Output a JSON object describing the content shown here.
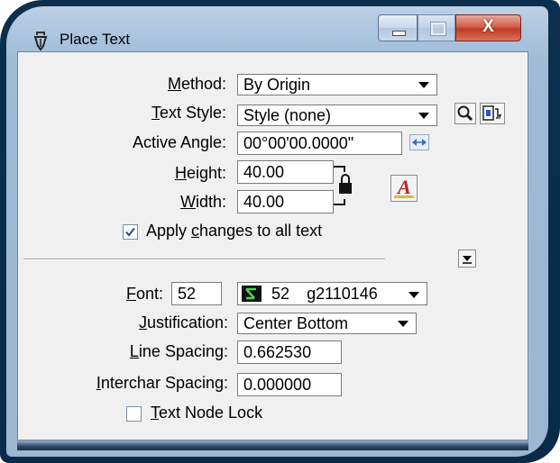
{
  "window": {
    "title": "Place Text",
    "close_glyph": "X"
  },
  "form": {
    "method": {
      "label_pre": "",
      "label_ul": "M",
      "label_post": "ethod:",
      "value": "By Origin"
    },
    "text_style": {
      "label_pre": "",
      "label_ul": "T",
      "label_post": "ext Style:",
      "value": "Style (none)"
    },
    "active_angle": {
      "label": "Active Angle:",
      "value": "00°00'00.0000\""
    },
    "height": {
      "label_pre": "",
      "label_ul": "H",
      "label_post": "eight:",
      "value": "40.00"
    },
    "width": {
      "label_pre": "",
      "label_ul": "W",
      "label_post": "idth:",
      "value": "40.00"
    },
    "apply_changes": {
      "label_pre": "Apply ",
      "label_ul": "c",
      "label_post": "hanges to all text",
      "checked": true
    },
    "font": {
      "label_pre": "",
      "label_ul": "F",
      "label_post": "ont:",
      "number": "52",
      "combo_num": "52",
      "combo_name": "g2110146"
    },
    "justification": {
      "label_pre": "",
      "label_ul": "J",
      "label_post": "ustification:",
      "value": "Center Bottom"
    },
    "line_spacing": {
      "label_pre": "",
      "label_ul": "L",
      "label_post": "ine Spacing:",
      "value": "0.662530"
    },
    "interchar_spacing": {
      "label_pre": "",
      "label_ul": "I",
      "label_post": "nterchar Spacing:",
      "value": "0.000000"
    },
    "text_node_lock": {
      "label_pre": "",
      "label_ul": "T",
      "label_post": "ext Node Lock",
      "checked": false
    }
  },
  "icons": {
    "title": "pen-icon",
    "magnifier": "magnifier-icon",
    "style_edit": "text-style-edit-icon",
    "angle_spin": "spinner-arrows-icon",
    "lock": "lock-icon",
    "font_preview": "font-a-icon",
    "expand": "expand-arrow-icon",
    "font_type": "font-type-icon"
  }
}
